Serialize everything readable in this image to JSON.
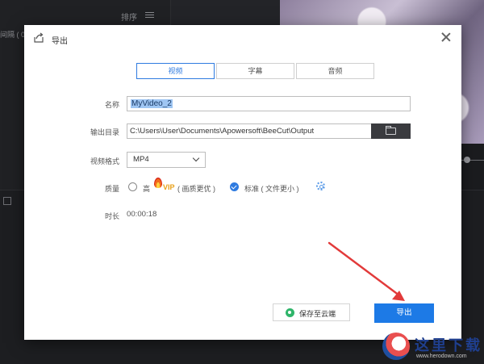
{
  "background": {
    "sort_label": "排序",
    "left_label": "间隔 ( 0",
    "logo": {
      "text": "这里下载",
      "url": "www.herodown.com"
    }
  },
  "dialog": {
    "title": "导出",
    "tabs": [
      {
        "label": "视频",
        "active": true
      },
      {
        "label": "字幕",
        "active": false
      },
      {
        "label": "音频",
        "active": false
      }
    ],
    "fields": {
      "name": {
        "label": "名称",
        "value": "MyVideo_2"
      },
      "output_dir": {
        "label": "输出目录",
        "value": "C:\\Users\\User\\Documents\\Apowersoft\\BeeCut\\Output"
      },
      "format": {
        "label": "视频格式",
        "value": "MP4"
      },
      "quality": {
        "label": "质量",
        "options": [
          {
            "label": "高",
            "badge": "VIP",
            "hint": "( 画质更优 )",
            "checked": false
          },
          {
            "label": "标准 ( 文件更小 )",
            "checked": true
          }
        ]
      },
      "duration": {
        "label": "时长",
        "value": "00:00:18"
      }
    },
    "buttons": {
      "save_cloud": "保存至云端",
      "export": "导出"
    }
  },
  "colors": {
    "accent": "#1d7ae6",
    "annotation_arrow": "#e23a3a",
    "vip": "#e8a017"
  }
}
